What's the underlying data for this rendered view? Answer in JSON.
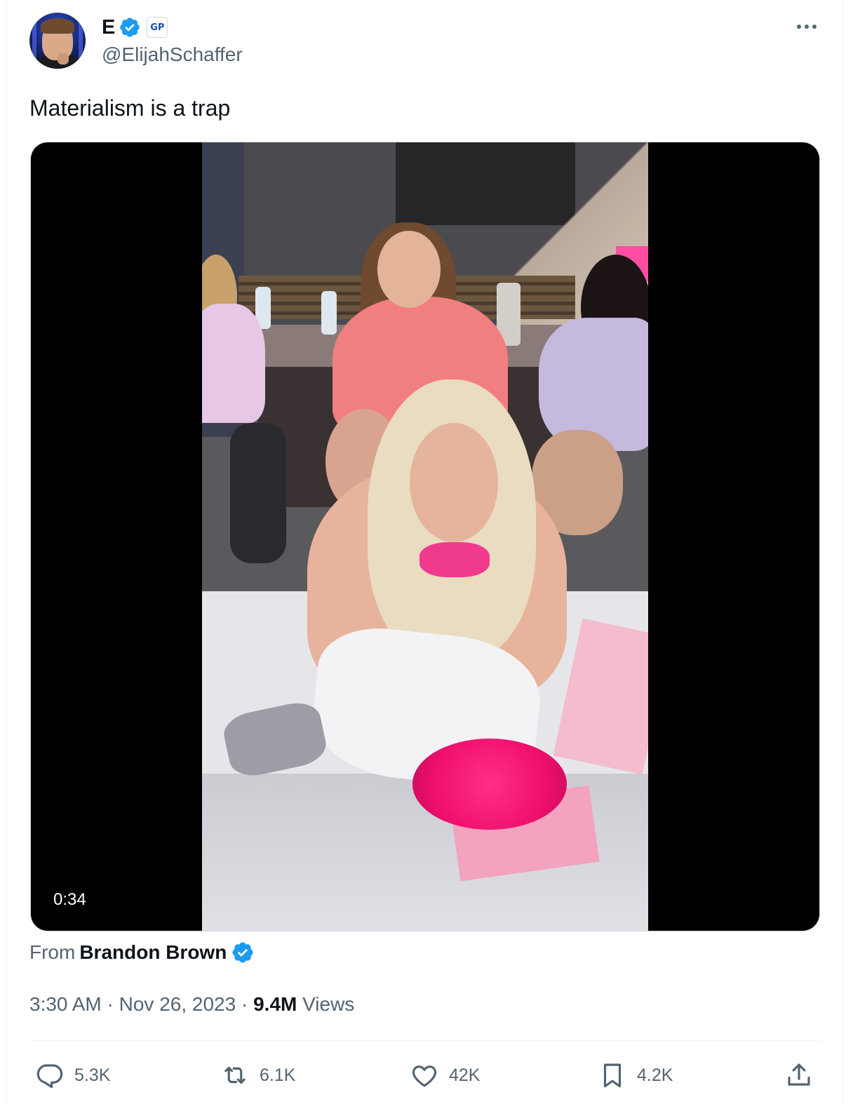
{
  "author": {
    "display_name": "E",
    "handle": "@ElijahSchaffer",
    "affiliate_badge": "GP",
    "verified_color": "#1d9bf0"
  },
  "tweet": {
    "text": "Materialism is a trap"
  },
  "media": {
    "type": "video",
    "duration": "0:34"
  },
  "source": {
    "from_label": "From",
    "name": "Brandon Brown"
  },
  "meta": {
    "time": "3:30 AM",
    "separator": " · ",
    "date": "Nov 26, 2023",
    "views_count": "9.4M",
    "views_label": " Views"
  },
  "actions": {
    "reply": {
      "count": "5.3K",
      "icon": "reply-icon"
    },
    "retweet": {
      "count": "6.1K",
      "icon": "retweet-icon"
    },
    "like": {
      "count": "42K",
      "icon": "heart-icon"
    },
    "bookmark": {
      "count": "4.2K",
      "icon": "bookmark-icon"
    },
    "share": {
      "icon": "share-icon"
    }
  },
  "colors": {
    "text_primary": "#0f1419",
    "text_secondary": "#536471",
    "accent_blue": "#1d9bf0"
  }
}
